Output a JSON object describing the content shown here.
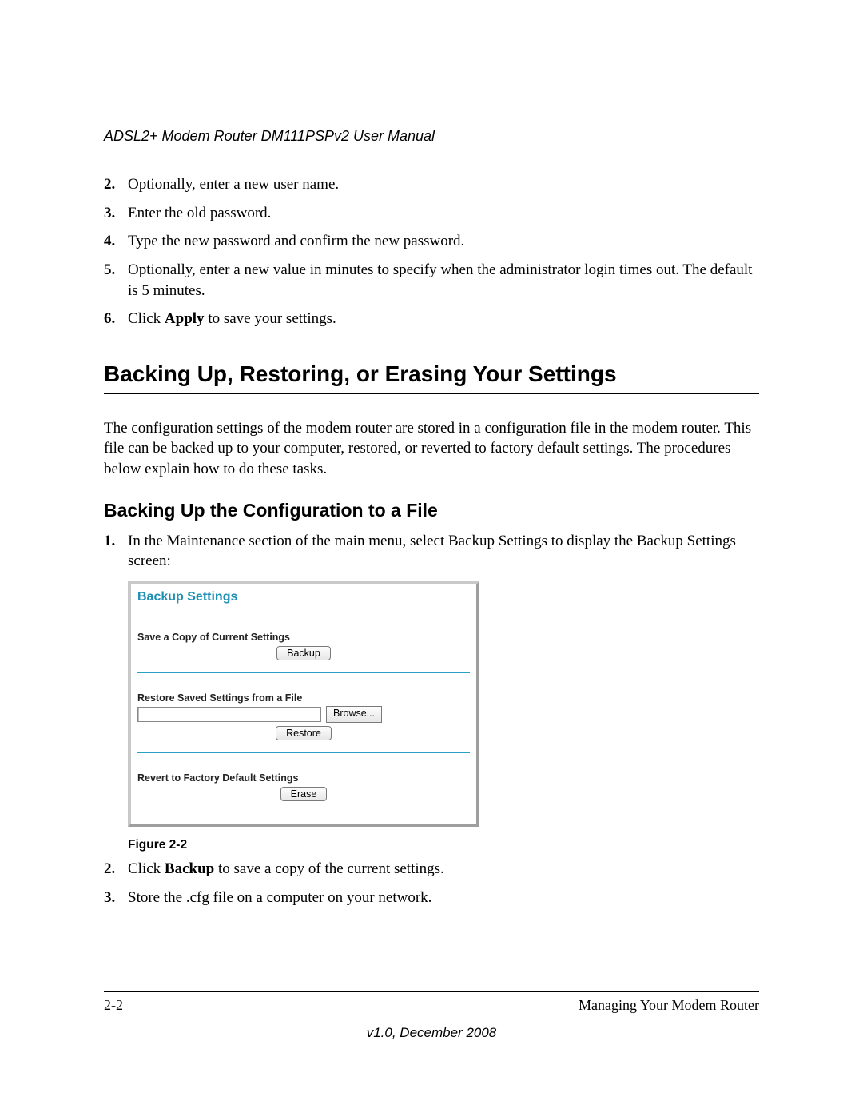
{
  "header": {
    "running_title": "ADSL2+ Modem Router DM111PSPv2 User Manual"
  },
  "steps_a": [
    {
      "num": "2.",
      "text": "Optionally, enter a new user name."
    },
    {
      "num": "3.",
      "text": "Enter the old password."
    },
    {
      "num": "4.",
      "text": "Type the new password and confirm the new password."
    },
    {
      "num": "5.",
      "text": "Optionally, enter a new value in minutes to specify when the administrator login times out. The default is 5 minutes."
    },
    {
      "num": "6.",
      "pre": "Click ",
      "bold": "Apply",
      "post": " to save your settings."
    }
  ],
  "section_heading": "Backing Up, Restoring, or Erasing Your Settings",
  "section_intro": "The configuration settings of the modem router are stored in a configuration file in the modem router. This file can be backed up to your computer, restored, or reverted to factory default settings. The procedures below explain how to do these tasks.",
  "subsection_heading": "Backing Up the Configuration to a File",
  "steps_b_1": {
    "num": "1.",
    "text": "In the Maintenance section of the main menu, select Backup Settings to display the Backup Settings screen:"
  },
  "panel": {
    "title": "Backup Settings",
    "save_label": "Save a Copy of Current Settings",
    "backup_btn": "Backup",
    "restore_label": "Restore Saved Settings from a File",
    "browse_btn": "Browse...",
    "restore_btn": "Restore",
    "revert_label": "Revert to Factory Default Settings",
    "erase_btn": "Erase"
  },
  "figure_caption": "Figure 2-2",
  "steps_b_rest": [
    {
      "num": "2.",
      "pre": "Click ",
      "bold": "Backup",
      "post": " to save a copy of the current settings."
    },
    {
      "num": "3.",
      "text": "Store the .cfg file on a computer on your network."
    }
  ],
  "footer": {
    "page_num": "2-2",
    "chapter": "Managing Your Modem Router",
    "version": "v1.0, December 2008"
  }
}
